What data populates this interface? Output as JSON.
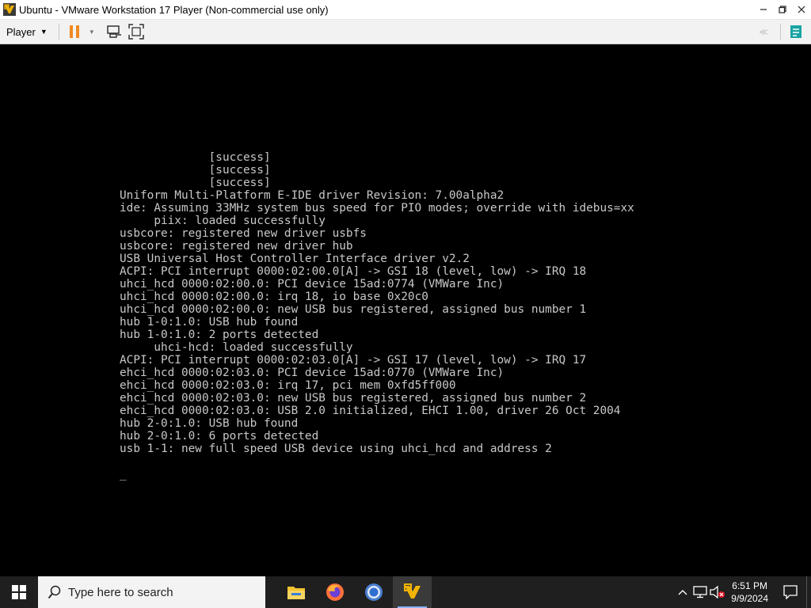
{
  "window": {
    "title": "Ubuntu - VMware Workstation 17 Player (Non-commercial use only)",
    "icons": [
      "vmware-app-icon",
      "minimize-icon",
      "maximize-icon",
      "close-icon"
    ]
  },
  "toolbar": {
    "player_menu_label": "Player",
    "icons": [
      "pause-icon",
      "dropdown-icon",
      "send-ctrl-alt-del-icon",
      "fullscreen-icon",
      "back-arrow-icon",
      "notes-icon"
    ],
    "colors": {
      "pause": "#f08a24",
      "notes": "#1aa3a3"
    }
  },
  "console": {
    "lines": [
      "             [success]",
      "             [success]",
      "             [success]",
      "Uniform Multi-Platform E-IDE driver Revision: 7.00alpha2",
      "ide: Assuming 33MHz system bus speed for PIO modes; override with idebus=xx",
      "     piix: loaded successfully",
      "usbcore: registered new driver usbfs",
      "usbcore: registered new driver hub",
      "USB Universal Host Controller Interface driver v2.2",
      "ACPI: PCI interrupt 0000:02:00.0[A] -> GSI 18 (level, low) -> IRQ 18",
      "uhci_hcd 0000:02:00.0: PCI device 15ad:0774 (VMWare Inc)",
      "uhci_hcd 0000:02:00.0: irq 18, io base 0x20c0",
      "uhci_hcd 0000:02:00.0: new USB bus registered, assigned bus number 1",
      "hub 1-0:1.0: USB hub found",
      "hub 1-0:1.0: 2 ports detected",
      "     uhci-hcd: loaded successfully",
      "ACPI: PCI interrupt 0000:02:03.0[A] -> GSI 17 (level, low) -> IRQ 17",
      "ehci_hcd 0000:02:03.0: PCI device 15ad:0770 (VMWare Inc)",
      "ehci_hcd 0000:02:03.0: irq 17, pci mem 0xfd5ff000",
      "ehci_hcd 0000:02:03.0: new USB bus registered, assigned bus number 2",
      "ehci_hcd 0000:02:03.0: USB 2.0 initialized, EHCI 1.00, driver 26 Oct 2004",
      "hub 2-0:1.0: USB hub found",
      "hub 2-0:1.0: 6 ports detected",
      "usb 1-1: new full speed USB device using uhci_hcd and address 2",
      "",
      "_"
    ]
  },
  "taskbar": {
    "search_placeholder": "Type here to search",
    "apps": [
      "file-explorer-icon",
      "firefox-icon",
      "chrome-icon",
      "vmware-player-icon"
    ],
    "active_app": "vmware-player-icon",
    "tray_icons": [
      "chevron-up-icon",
      "network-icon",
      "volume-muted-icon"
    ],
    "clock_time": "6:51 PM",
    "clock_date": "9/9/2024"
  }
}
